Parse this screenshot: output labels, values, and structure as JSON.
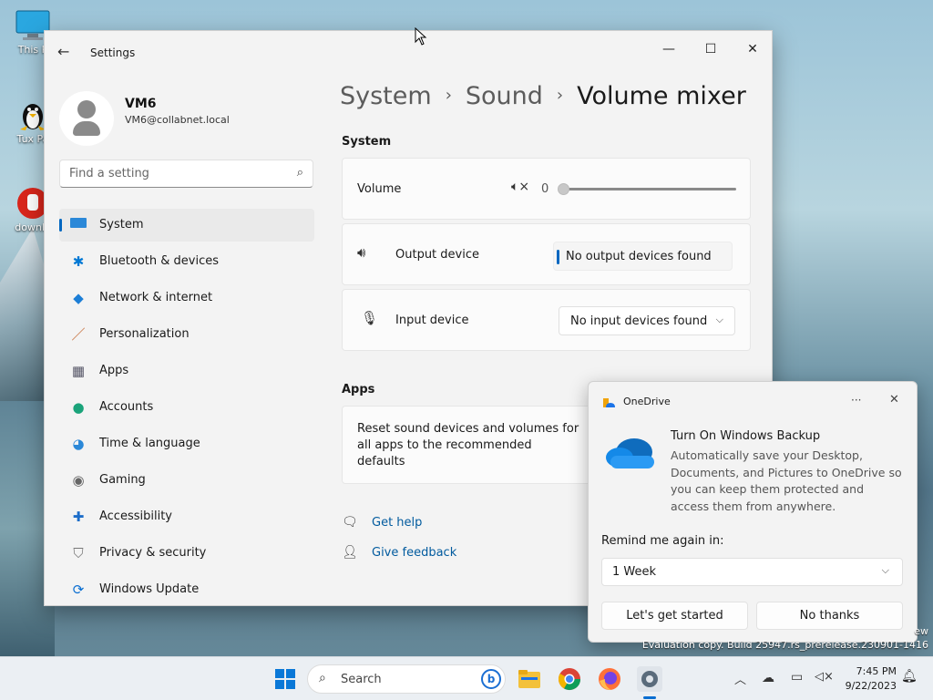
{
  "desktop": {
    "icons": [
      {
        "label": "This P",
        "icon": "monitor-icon"
      },
      {
        "label": "Tux Pa",
        "icon": "tux-icon"
      },
      {
        "label": "downlo",
        "icon": "stop-hand-icon"
      }
    ],
    "watermark": {
      "line1": "ew",
      "line2": "Evaluation copy. Build 25947.rs_prerelease.230901-1416"
    }
  },
  "settings": {
    "app_title": "Settings",
    "profile": {
      "name": "VM6",
      "email": "VM6@collabnet.local"
    },
    "search_placeholder": "Find a setting",
    "nav": [
      {
        "label": "System",
        "icon": "system-icon",
        "selected": true
      },
      {
        "label": "Bluetooth & devices",
        "icon": "bluetooth-icon"
      },
      {
        "label": "Network & internet",
        "icon": "wifi-icon"
      },
      {
        "label": "Personalization",
        "icon": "brush-icon"
      },
      {
        "label": "Apps",
        "icon": "apps-icon"
      },
      {
        "label": "Accounts",
        "icon": "account-icon"
      },
      {
        "label": "Time & language",
        "icon": "globe-clock-icon"
      },
      {
        "label": "Gaming",
        "icon": "gamepad-icon"
      },
      {
        "label": "Accessibility",
        "icon": "accessibility-icon"
      },
      {
        "label": "Privacy & security",
        "icon": "shield-icon"
      },
      {
        "label": "Windows Update",
        "icon": "update-icon"
      }
    ],
    "breadcrumb": {
      "crumb1": "System",
      "crumb2": "Sound",
      "current": "Volume mixer",
      "separator": "›"
    },
    "system_section": "System",
    "volume": {
      "label": "Volume",
      "value": "0",
      "level": 0
    },
    "output": {
      "label": "Output device",
      "value": "No output devices found"
    },
    "input": {
      "label": "Input device",
      "value": "No input devices found"
    },
    "apps_section": "Apps",
    "reset_text": "Reset sound devices and volumes for all apps to the recommended defaults",
    "get_help": "Get help",
    "give_feedback": "Give feedback",
    "accent_color": "#0067c0"
  },
  "onedrive": {
    "title": "OneDrive",
    "more": "···",
    "heading": "Turn On Windows Backup",
    "body": "Automatically save your Desktop, Documents, and Pictures to OneDrive so you can keep them protected and access them from anywhere.",
    "remind_label": "Remind me again in:",
    "remind_value": "1 Week",
    "primary_button": "Let's get started",
    "secondary_button": "No thanks"
  },
  "taskbar": {
    "search_label": "Search",
    "pinned": [
      "start-icon",
      "file-explorer-icon",
      "chrome-icon",
      "firefox-icon",
      "settings-icon"
    ],
    "time": "7:45 PM",
    "date": "9/22/2023"
  }
}
